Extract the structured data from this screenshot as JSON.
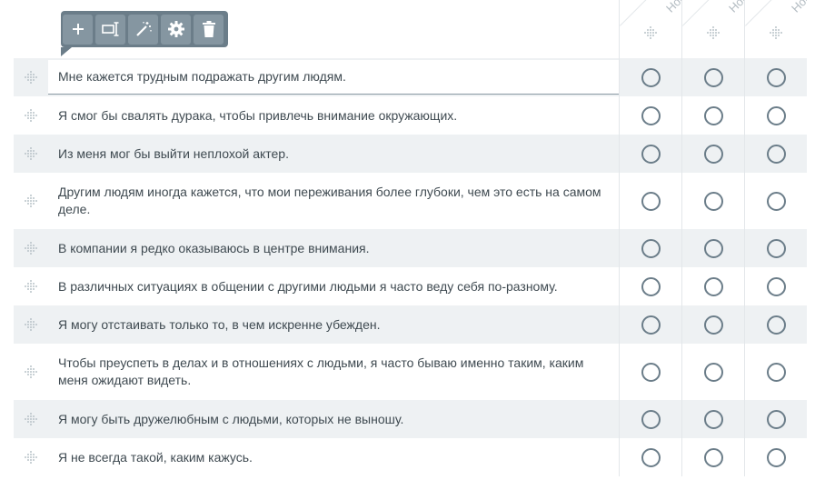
{
  "toolbar": {
    "buttons": [
      {
        "name": "add-button",
        "icon": "plus-icon"
      },
      {
        "name": "rename-button",
        "icon": "text-field-icon"
      },
      {
        "name": "magic-button",
        "icon": "magic-wand-icon"
      },
      {
        "name": "settings-button",
        "icon": "gear-icon"
      },
      {
        "name": "delete-button",
        "icon": "trash-icon"
      }
    ]
  },
  "columns": [
    {
      "label": "Нов"
    },
    {
      "label": "Нов"
    },
    {
      "label": "Нов"
    }
  ],
  "questions": [
    {
      "text": "Мне кажется трудным подражать другим людям."
    },
    {
      "text": "Я смог бы свалять дурака, чтобы привлечь внимание окружающих."
    },
    {
      "text": "Из меня мог бы выйти неплохой актер."
    },
    {
      "text": "Другим людям иногда кажется, что мои переживания более глубоки, чем это есть на самом деле."
    },
    {
      "text": "В компании я редко оказываюсь в центре внимания."
    },
    {
      "text": "В различных ситуациях в общении с другими людьми я часто веду себя по-разному."
    },
    {
      "text": "Я могу отстаивать только то, в чем искренне убежден."
    },
    {
      "text": "Чтобы преуспеть в делах и в отношениях с людьми, я часто бываю именно таким, каким меня ожидают видеть."
    },
    {
      "text": "Я могу быть дружелюбным с людьми, которых не выношу."
    },
    {
      "text": "Я не всегда такой, каким кажусь."
    }
  ],
  "colors": {
    "accent": "#6b7d89",
    "row_alt": "#eef1f3",
    "toolbar_button": "#8596a1"
  }
}
